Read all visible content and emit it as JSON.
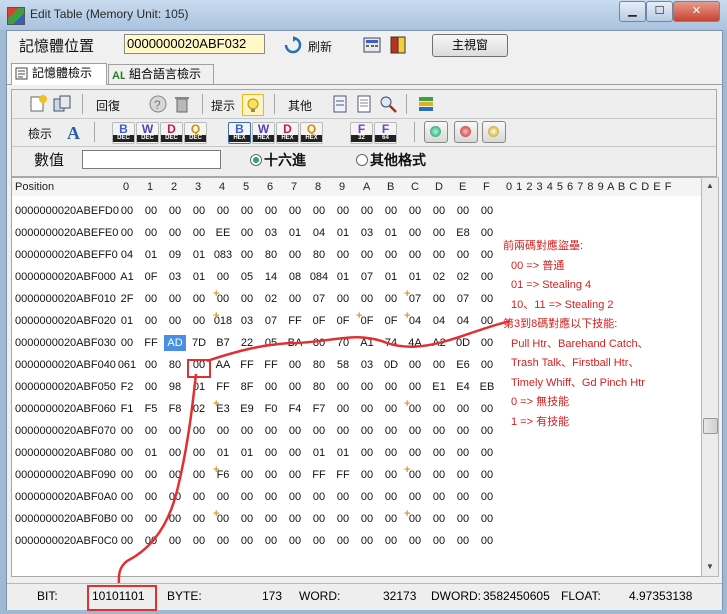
{
  "window": {
    "title": "Edit Table (Memory Unit: 105)"
  },
  "address_bar": {
    "label": "記憶體位置",
    "value": "0000000020ABF032",
    "refresh_label": "刷新",
    "main_window_label": "主視窗"
  },
  "tabs": [
    {
      "label": "記憶體檢示",
      "active": true
    },
    {
      "label": "組合語言檢示",
      "active": false
    }
  ],
  "toolbar": {
    "undo_label": "回復",
    "hint_label": "提示",
    "other_label": "其他",
    "view_label": "檢示",
    "code_buttons": [
      {
        "top": "B",
        "bottom": "DEC",
        "color": "#3a5fcd"
      },
      {
        "top": "W",
        "bottom": "DEC",
        "color": "#5a3fb0"
      },
      {
        "top": "D",
        "bottom": "DEC",
        "color": "#c02040"
      },
      {
        "top": "Q",
        "bottom": "DEC",
        "color": "#d09000"
      },
      {
        "top": "B",
        "bottom": "HEX",
        "color": "#3a5fcd"
      },
      {
        "top": "W",
        "bottom": "HEX",
        "color": "#5a3fb0"
      },
      {
        "top": "D",
        "bottom": "HEX",
        "color": "#c02040"
      },
      {
        "top": "Q",
        "bottom": "HEX",
        "color": "#d09000"
      },
      {
        "top": "F",
        "bottom": "32",
        "color": "#7a40c0"
      },
      {
        "top": "F",
        "bottom": "64",
        "color": "#7a40c0"
      }
    ],
    "value_label": "數值",
    "value_input": "",
    "radio_hex_label": "十六進",
    "radio_other_label": "其他格式"
  },
  "grid": {
    "header_position": "Position",
    "columns": [
      "0",
      "1",
      "2",
      "3",
      "4",
      "5",
      "6",
      "7",
      "8",
      "9",
      "A",
      "B",
      "C",
      "D",
      "E",
      "F"
    ],
    "ascii_header": "0 1 2 3 4 5 6 7 8 9 A B C D E F",
    "rows": [
      {
        "addr": "0000000020ABEFD0",
        "cells": [
          "00",
          "00",
          "00",
          "00",
          "00",
          "00",
          "00",
          "00",
          "00",
          "00",
          "00",
          "00",
          "00",
          "00",
          "00",
          "00"
        ]
      },
      {
        "addr": "0000000020ABEFE0",
        "cells": [
          "00",
          "00",
          "00",
          "00",
          "EE",
          "00",
          "03",
          "01",
          "04",
          "01",
          "03",
          "01",
          "00",
          "00",
          "E8",
          "00"
        ]
      },
      {
        "addr": "0000000020ABEFF0",
        "cells": [
          "04",
          "01",
          "09",
          "01",
          "083",
          "00",
          "80",
          "00",
          "80",
          "00",
          "00",
          "00",
          "00",
          "00",
          "00",
          "00"
        ]
      },
      {
        "addr": "0000000020ABF000",
        "cells": [
          "A1",
          "0F",
          "03",
          "01",
          "00",
          "05",
          "14",
          "08",
          "084",
          "01",
          "07",
          "01",
          "01",
          "02",
          "02",
          "00"
        ]
      },
      {
        "addr": "0000000020ABF010",
        "cells": [
          "2F",
          "00",
          "00",
          "00",
          "00",
          "00",
          "02",
          "00",
          "07",
          "00",
          "00",
          "00",
          "07",
          "00",
          "07",
          "00"
        ]
      },
      {
        "addr": "0000000020ABF020",
        "cells": [
          "01",
          "00",
          "00",
          "00",
          "018",
          "03",
          "07",
          "FF",
          "0F",
          "0F",
          "0F",
          "0F",
          "04",
          "04",
          "04",
          "00"
        ]
      },
      {
        "addr": "0000000020ABF030",
        "cells": [
          "00",
          "FF",
          "AD",
          "7D",
          "B7",
          "22",
          "05",
          "BA",
          "80",
          "70",
          "A1",
          "74",
          "4A",
          "A2",
          "0D",
          "00"
        ]
      },
      {
        "addr": "0000000020ABF040",
        "cells": [
          "061",
          "00",
          "80",
          "00",
          "AA",
          "FF",
          "FF",
          "00",
          "80",
          "58",
          "03",
          "0D",
          "00",
          "00",
          "E6",
          "00"
        ]
      },
      {
        "addr": "0000000020ABF050",
        "cells": [
          "F2",
          "00",
          "98",
          "01",
          "FF",
          "8F",
          "00",
          "00",
          "80",
          "00",
          "00",
          "00",
          "00",
          "E1",
          "E4",
          "EB"
        ]
      },
      {
        "addr": "0000000020ABF060",
        "cells": [
          "F1",
          "F5",
          "F8",
          "02",
          "E3",
          "E9",
          "F0",
          "F4",
          "F7",
          "00",
          "00",
          "00",
          "00",
          "00",
          "00",
          "00"
        ]
      },
      {
        "addr": "0000000020ABF070",
        "cells": [
          "00",
          "00",
          "00",
          "00",
          "00",
          "00",
          "00",
          "00",
          "00",
          "00",
          "00",
          "00",
          "00",
          "00",
          "00",
          "00"
        ]
      },
      {
        "addr": "0000000020ABF080",
        "cells": [
          "00",
          "01",
          "00",
          "00",
          "01",
          "01",
          "00",
          "00",
          "01",
          "01",
          "00",
          "00",
          "00",
          "00",
          "00",
          "00"
        ]
      },
      {
        "addr": "0000000020ABF090",
        "cells": [
          "00",
          "00",
          "00",
          "00",
          "F6",
          "00",
          "00",
          "00",
          "FF",
          "FF",
          "00",
          "00",
          "00",
          "00",
          "00",
          "00"
        ]
      },
      {
        "addr": "0000000020ABF0A0",
        "cells": [
          "00",
          "00",
          "00",
          "00",
          "00",
          "00",
          "00",
          "00",
          "00",
          "00",
          "00",
          "00",
          "00",
          "00",
          "00",
          "00"
        ]
      },
      {
        "addr": "0000000020ABF0B0",
        "cells": [
          "00",
          "00",
          "00",
          "00",
          "00",
          "00",
          "00",
          "00",
          "00",
          "00",
          "00",
          "00",
          "00",
          "00",
          "00",
          "00"
        ]
      },
      {
        "addr": "0000000020ABF0C0",
        "cells": [
          "00",
          "00",
          "00",
          "00",
          "00",
          "00",
          "00",
          "00",
          "00",
          "00",
          "00",
          "00",
          "00",
          "00",
          "00",
          "00"
        ]
      }
    ]
  },
  "notes": [
    "前兩碼對應盜壘:",
    "  00 => 普通",
    "  01 => Stealing 4",
    "  10、11 => Stealing 2",
    "第3到8碼對應以下技能:",
    "  Pull Htr、Barehand Catch、",
    "  Trash Talk、Firstball Htr、",
    "  Timely Whiff、Gd Pinch Htr",
    "  0 => 無技能",
    "  1 => 有技能"
  ],
  "status": {
    "bit_label": "BIT:",
    "bit_value": "10101101",
    "byte_label": "BYTE:",
    "byte_value": "173",
    "word_label": "WORD:",
    "word_value": "32173",
    "dword_label": "DWORD:",
    "dword_value": "3582450605",
    "float_label": "FLOAT:",
    "float_value": "4.97353138"
  },
  "colors": {
    "annotation_red": "#e23030",
    "selected_cell": "#4a90e2"
  }
}
